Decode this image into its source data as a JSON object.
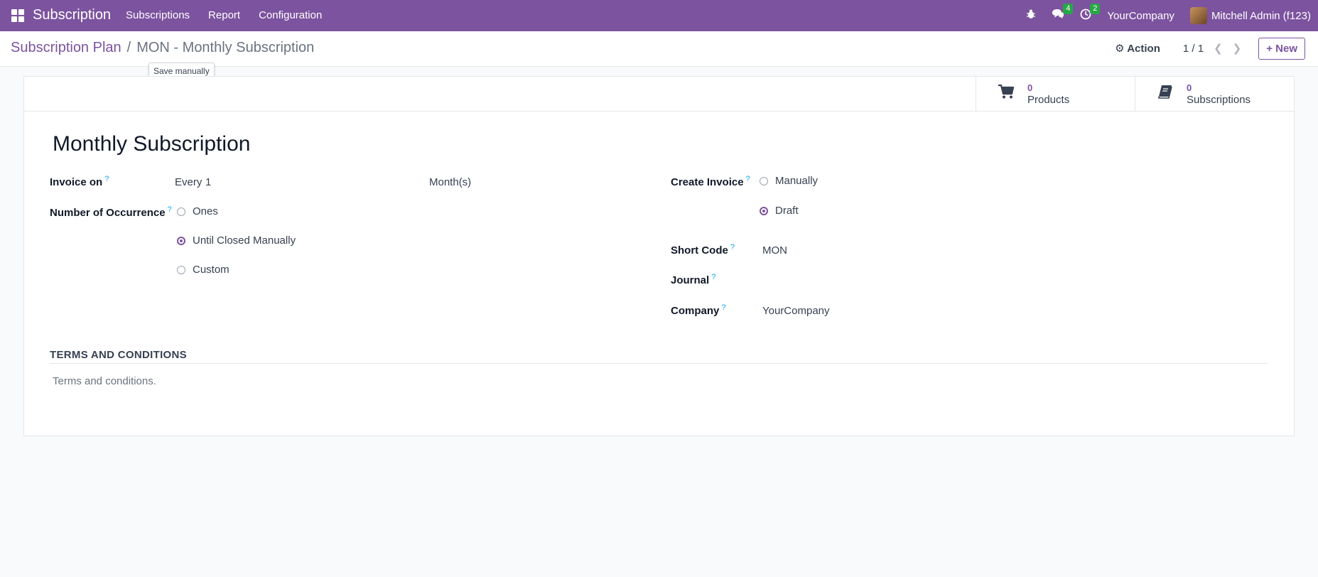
{
  "navbar": {
    "app_title": "Subscription",
    "menu": [
      "Subscriptions",
      "Report",
      "Configuration"
    ],
    "messages_count": "4",
    "activities_count": "2",
    "company": "YourCompany",
    "user": "Mitchell Admin (f123)"
  },
  "control": {
    "breadcrumb_parent": "Subscription Plan",
    "breadcrumb_separator": "/",
    "breadcrumb_current": "MON - Monthly Subscription",
    "action_label": "Action",
    "pager": "1 / 1",
    "new_label": "New",
    "tooltip": "Save manually"
  },
  "stats": {
    "products_value": "0",
    "products_label": "Products",
    "subscriptions_value": "0",
    "subscriptions_label": "Subscriptions"
  },
  "form": {
    "title": "Monthly Subscription",
    "invoice_on_label": "Invoice on",
    "invoice_every": "Every",
    "invoice_interval": "1",
    "invoice_unit": "Month(s)",
    "occurrence_label": "Number of Occurrence",
    "occurrence_options": [
      "Ones",
      "Until Closed Manually",
      "Custom"
    ],
    "occurrence_selected": "Until Closed Manually",
    "create_invoice_label": "Create Invoice",
    "create_invoice_options": [
      "Manually",
      "Draft"
    ],
    "create_invoice_selected": "Draft",
    "short_code_label": "Short Code",
    "short_code": "MON",
    "journal_label": "Journal",
    "company_label": "Company",
    "company": "YourCompany",
    "help_mark": "?"
  },
  "terms": {
    "section_title": "TERMS AND CONDITIONS",
    "placeholder": "Terms and conditions."
  },
  "colors": {
    "brand": "#7c539f",
    "badge": "#27a745"
  }
}
